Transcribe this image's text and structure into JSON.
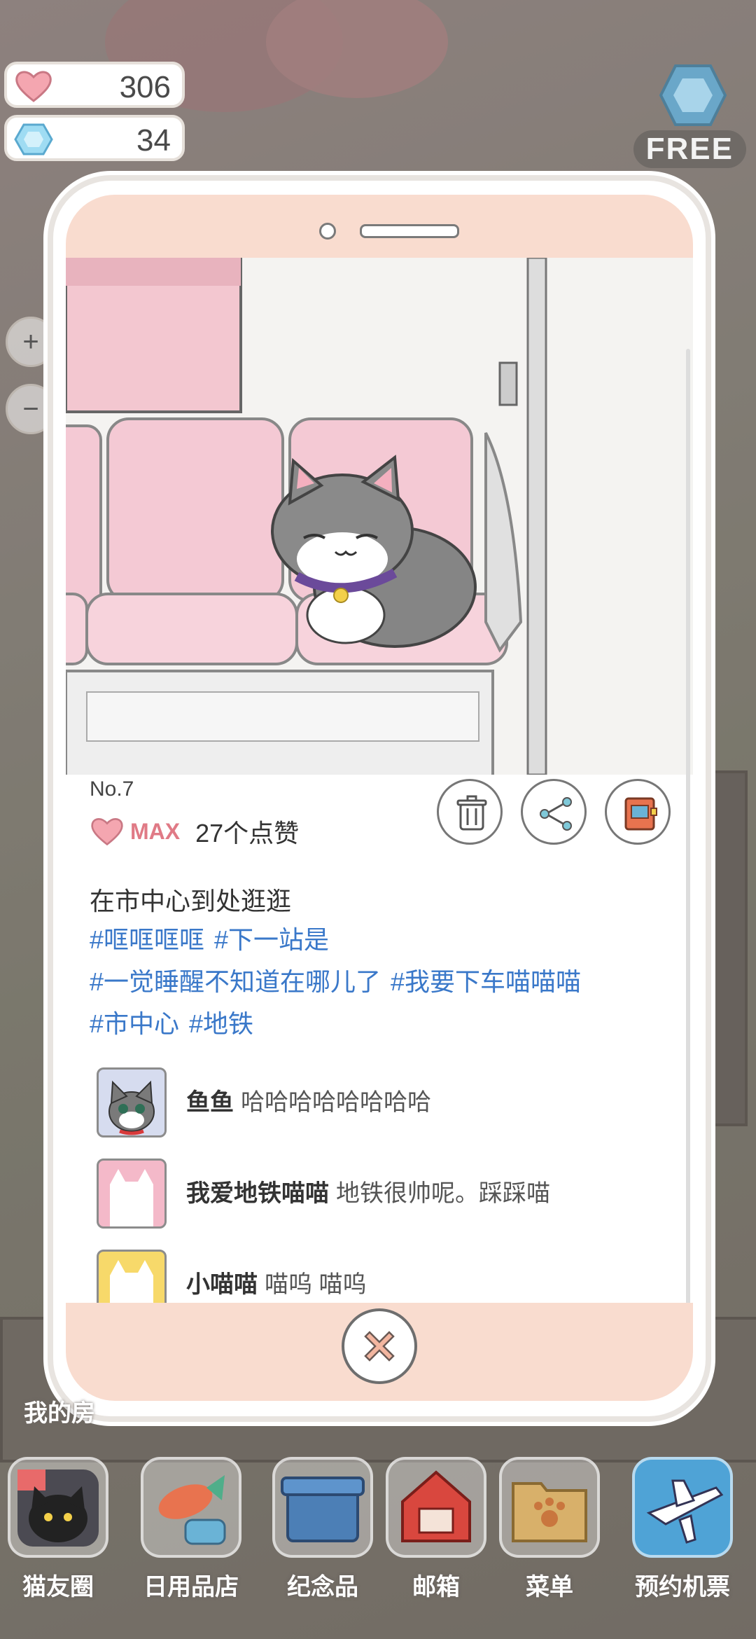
{
  "stats": {
    "hearts": "306",
    "gems": "34",
    "free_label": "FREE"
  },
  "side_label": "我的房",
  "post": {
    "number": "No.7",
    "max_label": "MAX",
    "likes_text": "27个点赞",
    "caption": "在市中心到处逛逛",
    "tags": [
      "#哐哐哐哐",
      "#下一站是",
      "#一觉睡醒不知道在哪儿了",
      "#我要下车喵喵喵",
      "#市中心",
      "#地铁"
    ],
    "comments": [
      {
        "name": "鱼鱼",
        "text": "哈哈哈哈哈哈哈哈",
        "avatar": "grey-cat-avatar"
      },
      {
        "name": "我爱地铁喵喵",
        "text": "地铁很帅呢。踩踩喵",
        "avatar": "pink-cat-silhouette"
      },
      {
        "name": "小喵喵",
        "text": "喵呜 喵呜",
        "avatar": "yellow-cat-silhouette"
      }
    ]
  },
  "actions": {
    "delete_icon": "trash-icon",
    "share_icon": "share-icon",
    "album_icon": "album-book-icon",
    "close_icon": "close-x-icon"
  },
  "nav": [
    {
      "label": "猫友圈",
      "icon": "black-cat-camera-icon"
    },
    {
      "label": "日用品店",
      "icon": "fish-toy-icon"
    },
    {
      "label": "纪念品",
      "icon": "gift-box-icon"
    },
    {
      "label": "邮箱",
      "icon": "red-mailbox-icon"
    },
    {
      "label": "菜单",
      "icon": "folder-paw-icon"
    },
    {
      "label": "预约机票",
      "icon": "airplane-icon"
    }
  ],
  "colors": {
    "accent_pink": "#f9dccf",
    "hashtag_blue": "#3a78c9",
    "heart_pink": "#f4a6b0",
    "max_text": "#e07a86"
  }
}
